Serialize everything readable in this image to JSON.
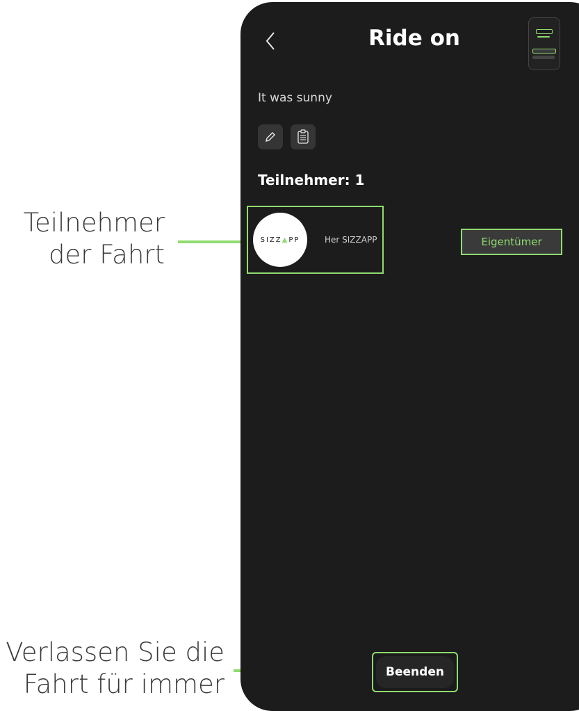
{
  "annotations": {
    "participants": [
      "Teilnehmer",
      "der Fahrt"
    ],
    "leave": [
      "Verlassen Sie die",
      "Fahrt für immer"
    ]
  },
  "header": {
    "title": "Ride on",
    "back_icon": "chevron-left-icon"
  },
  "ride": {
    "description": "It was sunny",
    "actions": [
      {
        "icon": "pencil-icon"
      },
      {
        "icon": "clipboard-icon"
      }
    ]
  },
  "participants": {
    "heading": "Teilnehmer: 1",
    "items": [
      {
        "avatar_logo": "SIZZAPP",
        "name": "Her SIZZAPP",
        "role": "Eigentümer"
      }
    ]
  },
  "footer": {
    "end_label": "Beenden"
  },
  "colors": {
    "accent": "#8fdc6f",
    "background": "#1c1c1c",
    "button": "#353535"
  }
}
